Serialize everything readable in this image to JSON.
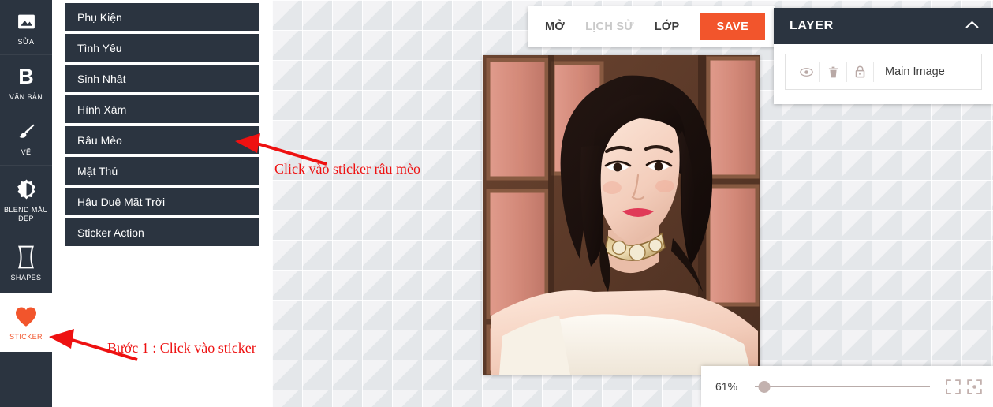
{
  "rail": {
    "items": [
      {
        "label": "SỬA",
        "icon": "image-icon",
        "name": "sidebar-item-sua",
        "active": false
      },
      {
        "label": "VĂN BẢN",
        "icon": "bold-text-icon",
        "name": "sidebar-item-van-ban",
        "active": false
      },
      {
        "label": "VẼ",
        "icon": "brush-icon",
        "name": "sidebar-item-ve",
        "active": false
      },
      {
        "label": "BLEND MÀU ĐẸP",
        "icon": "brightness-icon",
        "name": "sidebar-item-blend-mau-dep",
        "active": false
      },
      {
        "label": "SHAPES",
        "icon": "shape-icon",
        "name": "sidebar-item-shapes",
        "active": false
      },
      {
        "label": "STICKER",
        "icon": "heart-icon",
        "name": "sidebar-item-sticker",
        "active": true
      }
    ]
  },
  "sticker_panel": {
    "categories": [
      {
        "label": "Phụ Kiện"
      },
      {
        "label": "Tình Yêu"
      },
      {
        "label": "Sinh Nhật"
      },
      {
        "label": "Hình Xăm"
      },
      {
        "label": "Râu Mèo"
      },
      {
        "label": "Mặt Thú"
      },
      {
        "label": "Hậu Duệ Mặt Trời"
      },
      {
        "label": "Sticker Action"
      }
    ]
  },
  "toolbar": {
    "open_label": "MỞ",
    "history_label": "LỊCH SỬ",
    "layer_label": "LỚP",
    "save_label": "SAVE",
    "save_color": "#f2552c"
  },
  "layer_panel": {
    "title": "LAYER",
    "collapse_icon": "chevron-up-icon",
    "rows": [
      {
        "name": "Main Image",
        "visibility_icon": "eye-icon",
        "delete_icon": "trash-icon",
        "lock_icon": "lock-icon"
      }
    ]
  },
  "zoom_bar": {
    "value_label": "61%",
    "value_percent": 61,
    "fit_icon": "fit-screen-icon",
    "center_icon": "center-focus-icon"
  },
  "annotations": [
    {
      "text": "Click vào sticker râu mèo",
      "name": "annotation-sticker-rau-meo"
    },
    {
      "text": "Bước 1 : Click vào sticker",
      "name": "annotation-buoc-1"
    }
  ],
  "colors": {
    "dark_panel": "#2b3440",
    "accent": "#f2552c",
    "annotation_red": "#ee1111",
    "canvas_bg": "#e9eaec"
  }
}
